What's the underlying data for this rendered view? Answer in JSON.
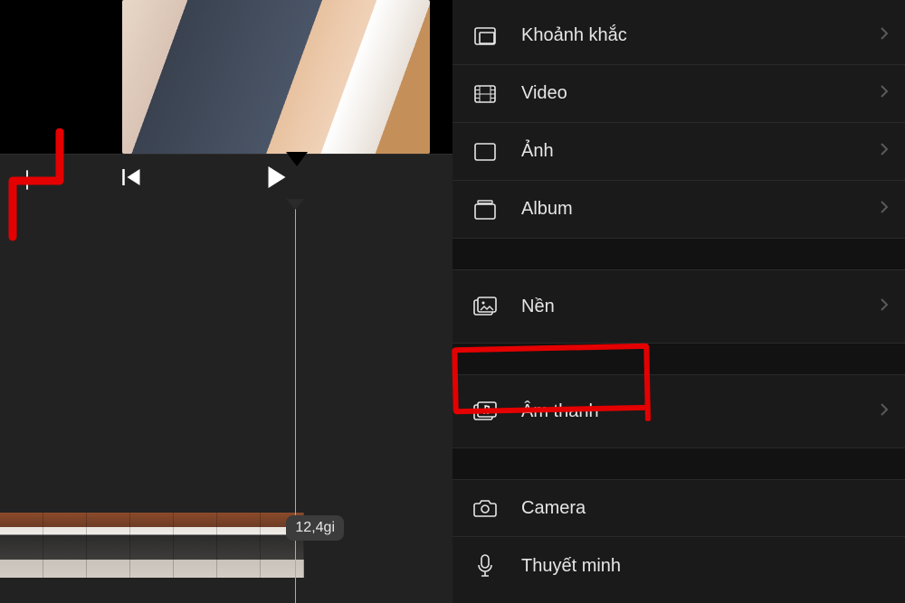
{
  "left": {
    "duration_label": "12,4gi"
  },
  "menu": {
    "items": [
      {
        "label": "Khoảnh khắc",
        "icon": "moments"
      },
      {
        "label": "Video",
        "icon": "film"
      },
      {
        "label": "Ảnh",
        "icon": "photo"
      },
      {
        "label": "Album",
        "icon": "album"
      }
    ],
    "section2": [
      {
        "label": "Nền",
        "icon": "background"
      }
    ],
    "section3": [
      {
        "label": "Âm thanh",
        "icon": "audio"
      }
    ],
    "section4": [
      {
        "label": "Camera",
        "icon": "camera"
      },
      {
        "label": "Thuyết minh",
        "icon": "mic"
      }
    ]
  }
}
